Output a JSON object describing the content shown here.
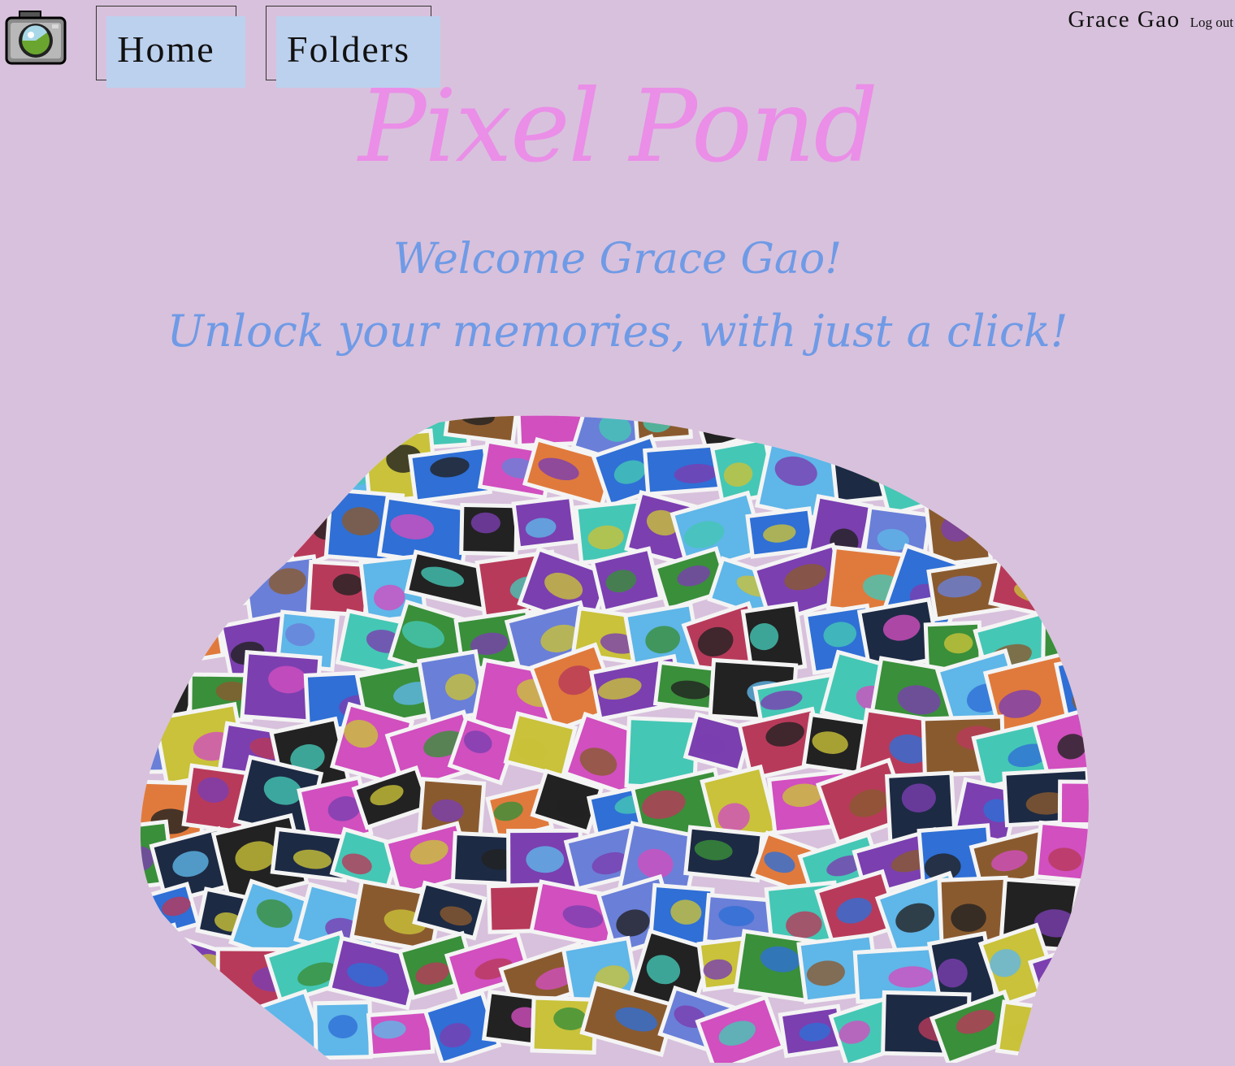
{
  "nav": {
    "logo_icon": "camera-icon",
    "home_label": "Home",
    "folders_label": "Folders"
  },
  "user": {
    "name": "Grace Gao",
    "logout_label": "Log out"
  },
  "hero": {
    "title": "Pixel Pond",
    "welcome": "Welcome Grace Gao!",
    "tagline": "Unlock your memories, with just a click!"
  },
  "colors": {
    "background": "#d8c1dc",
    "title": "#ea8ee8",
    "subtitle": "#6f9ae6",
    "nav_button_fill": "#bcd1ee"
  }
}
